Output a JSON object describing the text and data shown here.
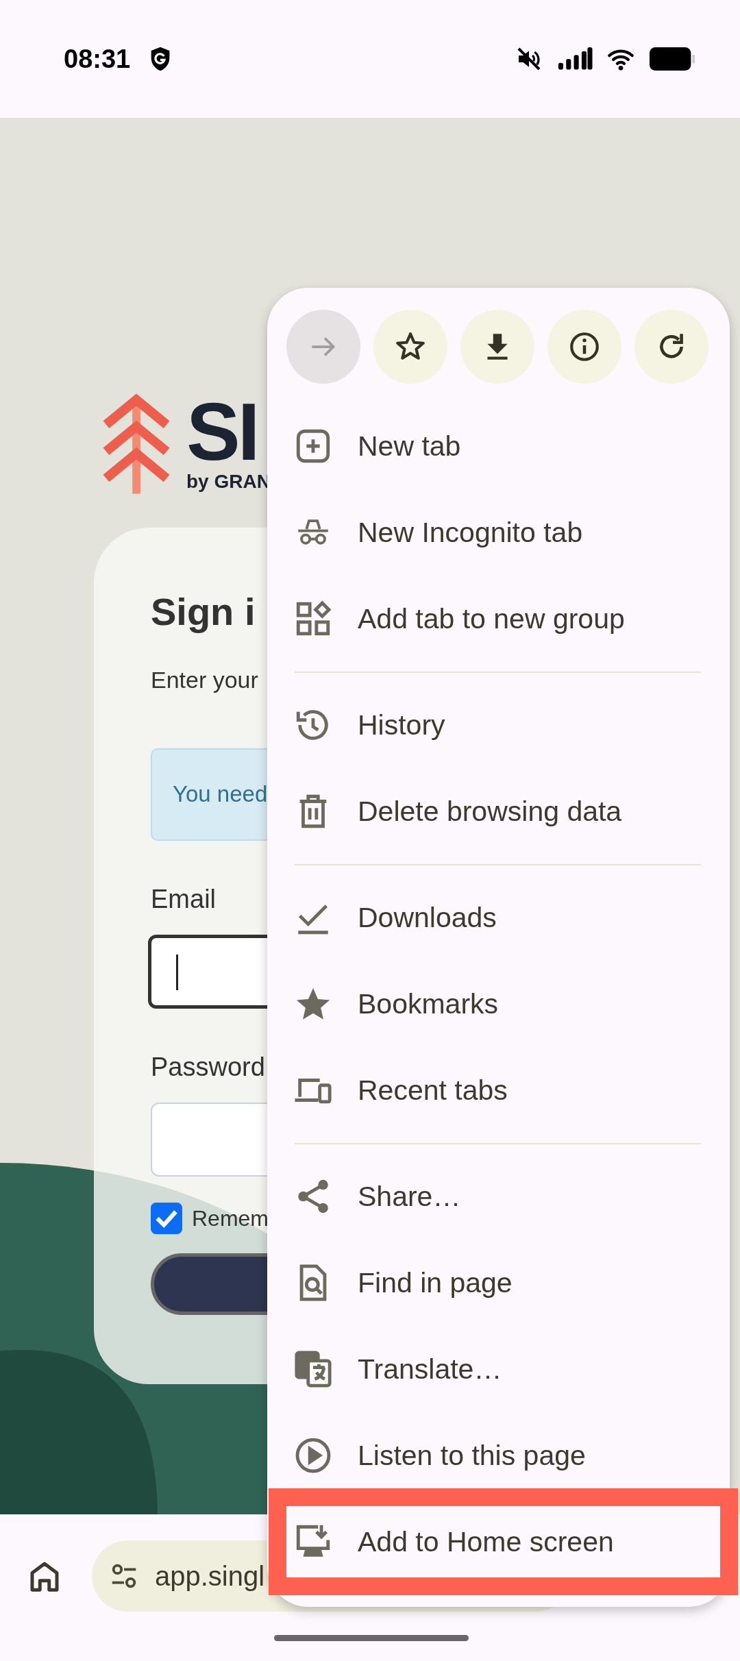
{
  "status_bar": {
    "time": "08:31"
  },
  "page": {
    "logo": {
      "wordmark": "SI",
      "byline": "by GRAN"
    },
    "card": {
      "title": "Sign i",
      "subtitle": "Enter your",
      "alert": "You need",
      "email_label": "Email",
      "email_field": {
        "focused": true
      },
      "password_label": "Password",
      "password_field": {
        "focused": false
      },
      "remember": {
        "label": "Remem",
        "checked": true
      }
    }
  },
  "menu": {
    "action_buttons": [
      {
        "kind": "forward",
        "disabled": true
      },
      {
        "kind": "bookmark",
        "disabled": false
      },
      {
        "kind": "download",
        "disabled": false
      },
      {
        "kind": "info",
        "disabled": false
      },
      {
        "kind": "reload",
        "disabled": false
      }
    ],
    "sections": [
      {
        "items": [
          {
            "label": "New tab",
            "kind": "new-tab",
            "highlighted": false
          },
          {
            "label": "New Incognito tab",
            "kind": "incognito",
            "highlighted": false
          },
          {
            "label": "Add tab to new group",
            "kind": "group",
            "highlighted": false
          }
        ]
      },
      {
        "items": [
          {
            "label": "History",
            "kind": "history",
            "highlighted": false
          },
          {
            "label": "Delete browsing data",
            "kind": "trash",
            "highlighted": false
          }
        ]
      },
      {
        "items": [
          {
            "label": "Downloads",
            "kind": "downloads",
            "highlighted": false
          },
          {
            "label": "Bookmarks",
            "kind": "bookmarks",
            "highlighted": false
          },
          {
            "label": "Recent tabs",
            "kind": "devices",
            "highlighted": false
          }
        ]
      },
      {
        "items": [
          {
            "label": "Share…",
            "kind": "share",
            "highlighted": false
          },
          {
            "label": "Find in page",
            "kind": "find",
            "highlighted": false
          },
          {
            "label": "Translate…",
            "kind": "translate",
            "highlighted": false
          },
          {
            "label": "Listen to this page",
            "kind": "listen",
            "highlighted": false
          },
          {
            "label": "Add to Home screen",
            "kind": "add-home",
            "highlighted": true
          }
        ]
      }
    ]
  },
  "toolbar": {
    "url": "app.singl"
  }
}
